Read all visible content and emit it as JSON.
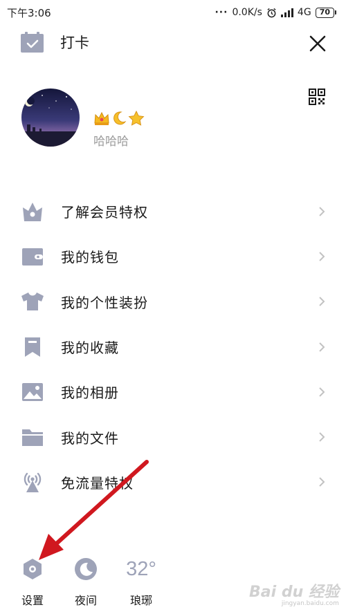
{
  "status_bar": {
    "time": "下午3:06",
    "network_speed": "0.0K/s",
    "network_type": "4G",
    "battery": "70"
  },
  "header": {
    "checkin_label": "打卡"
  },
  "profile": {
    "username": "哈哈哈"
  },
  "menu": {
    "items": [
      {
        "label": "了解会员特权",
        "icon": "crown-basket-icon"
      },
      {
        "label": "我的钱包",
        "icon": "wallet-icon"
      },
      {
        "label": "我的个性装扮",
        "icon": "tshirt-icon"
      },
      {
        "label": "我的收藏",
        "icon": "bookmark-icon"
      },
      {
        "label": "我的相册",
        "icon": "photo-icon"
      },
      {
        "label": "我的文件",
        "icon": "folder-icon"
      },
      {
        "label": "免流量特权",
        "icon": "antenna-icon"
      }
    ]
  },
  "bottom": {
    "settings_label": "设置",
    "night_label": "夜间",
    "temperature": "32°",
    "city": "琅琊"
  },
  "watermark": {
    "brand": "Bai du 经验",
    "url": "jingyan.baidu.com"
  },
  "colors": {
    "icon_gray": "#9ea3b8",
    "annotation_arrow": "#d0181f",
    "chevron": "#c2c2c2"
  }
}
